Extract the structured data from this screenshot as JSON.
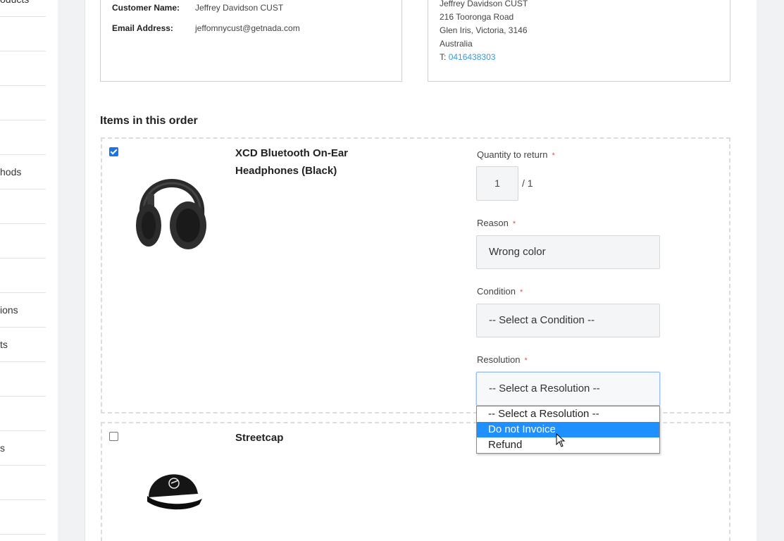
{
  "sidebar": {
    "items": [
      {
        "label": "oducts"
      },
      {
        "label": ""
      },
      {
        "label": ""
      },
      {
        "label": ""
      },
      {
        "label": ""
      },
      {
        "label": "hods"
      },
      {
        "label": ""
      },
      {
        "label": ""
      },
      {
        "label": ""
      },
      {
        "label": "ions"
      },
      {
        "label": "ts"
      },
      {
        "label": ""
      },
      {
        "label": ""
      },
      {
        "label": "s"
      },
      {
        "label": ""
      },
      {
        "label": ""
      }
    ]
  },
  "customer": {
    "name_label": "Customer Name:",
    "name_value": "Jeffrey Davidson CUST",
    "email_label": "Email Address:",
    "email_value": "jeffomnycust@getnada.com"
  },
  "address": {
    "name": "Jeffrey Davidson CUST",
    "street": "216 Tooronga Road",
    "city": "Glen Iris, Victoria, 3146",
    "country": "Australia",
    "phone_prefix": "T:",
    "phone": "0416438303"
  },
  "items_section": {
    "title": "Items in this order"
  },
  "items": [
    {
      "name_line1": "XCD Bluetooth On-Ear",
      "name_line2": "Headphones (Black)",
      "checked": true,
      "quantity_label": "Quantity to return",
      "quantity_value": "1",
      "quantity_total": "/ 1",
      "reason_label": "Reason",
      "reason_value": "Wrong color",
      "condition_label": "Condition",
      "condition_value": "-- Select a Condition --",
      "resolution_label": "Resolution",
      "resolution_value": "-- Select a Resolution --",
      "required_mark": "*"
    },
    {
      "name_line1": "Streetcap",
      "checked": false
    }
  ],
  "resolution_dropdown": {
    "options": [
      "-- Select a Resolution --",
      "Do not Invoice",
      "Refund"
    ],
    "highlighted": "Do not Invoice"
  },
  "colors": {
    "accent": "#1e90ff",
    "link": "#3a9ad9",
    "required": "#d9534f"
  }
}
